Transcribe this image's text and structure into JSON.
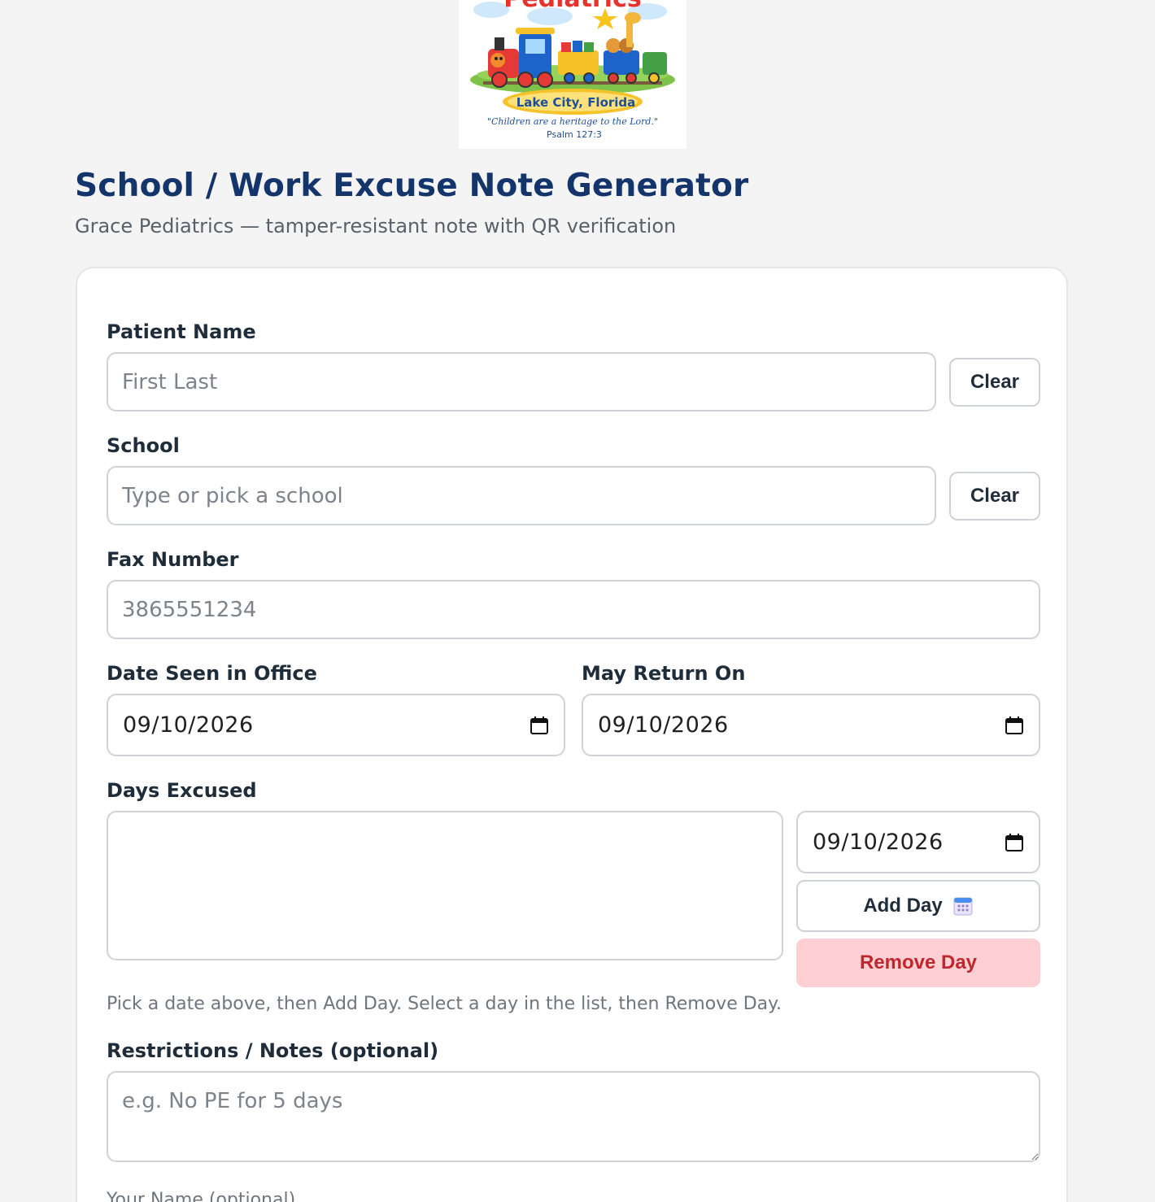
{
  "logo": {
    "title_fragment": "Pediatrics",
    "location": "Lake City, Florida",
    "verse": "\"Children are a heritage to the Lord.\"",
    "verse_ref": "Psalm 127:3"
  },
  "header": {
    "title": "School / Work Excuse Note Generator",
    "subtitle": "Grace Pediatrics — tamper-resistant note with QR verification"
  },
  "form": {
    "patient_name": {
      "label": "Patient Name",
      "placeholder": "First Last",
      "value": "",
      "clear_label": "Clear"
    },
    "school": {
      "label": "School",
      "placeholder": "Type or pick a school",
      "value": "",
      "clear_label": "Clear"
    },
    "fax": {
      "label": "Fax Number",
      "placeholder": "3865551234",
      "value": ""
    },
    "date_seen": {
      "label": "Date Seen in Office",
      "value": "09/10/2026"
    },
    "return_on": {
      "label": "May Return On",
      "value": "09/10/2026"
    },
    "days_excused": {
      "label": "Days Excused",
      "items": [],
      "picker_value": "09/10/2026",
      "add_label": "Add Day",
      "remove_label": "Remove Day",
      "hint": "Pick a date above, then Add Day. Select a day in the list, then Remove Day."
    },
    "notes": {
      "label": "Restrictions / Notes (optional)",
      "placeholder": "e.g. No PE for 5 days",
      "value": ""
    },
    "your_name": {
      "label": "Your Name (optional)"
    }
  },
  "colors": {
    "page_bg": "#f3f4f3",
    "title": "#14356b",
    "remove_bg": "#ffd0d3",
    "remove_text": "#c0262d"
  },
  "icons": {
    "calendar": "calendar-icon",
    "add_day": "calendar-emoji-icon"
  }
}
